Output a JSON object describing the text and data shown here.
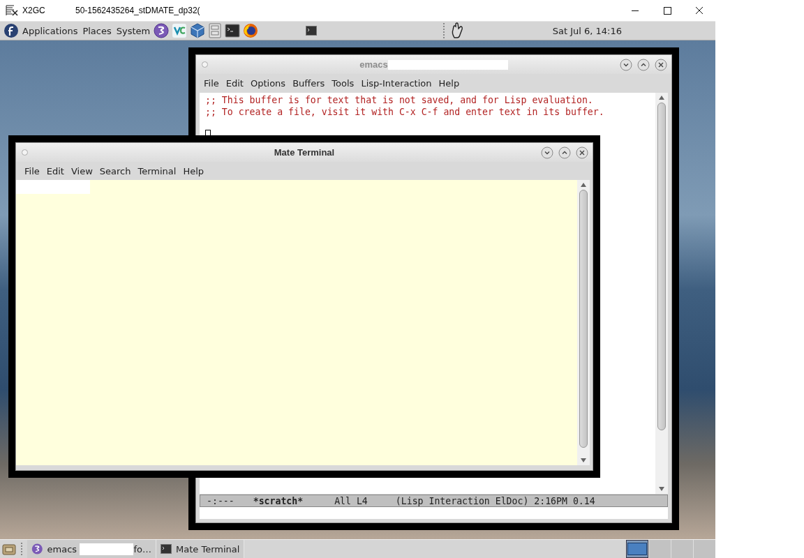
{
  "host_window": {
    "title": "X2GC",
    "session": "50-1562435264_stDMATE_dp32("
  },
  "panel": {
    "menus": [
      "Applications",
      "Places",
      "System"
    ],
    "launchers": [
      {
        "kind": "emacs"
      },
      {
        "kind": "vscode"
      },
      {
        "kind": "virtualbox"
      },
      {
        "kind": "cabinet"
      },
      {
        "kind": "terminal"
      },
      {
        "kind": "firefox"
      }
    ],
    "clock": "Sat Jul  6, 14:16"
  },
  "emacs_window": {
    "title": "emacs",
    "active": false,
    "menus": [
      "File",
      "Edit",
      "Options",
      "Buffers",
      "Tools",
      "Lisp-Interaction",
      "Help"
    ],
    "lines": [
      ";; This buffer is for text that is not saved, and for Lisp evaluation.",
      ";; To create a file, visit it with C-x C-f and enter text in its buffer."
    ],
    "mode_line": [
      {
        "text": "-:---",
        "bold": false
      },
      {
        "text": "*scratch*",
        "bold": true
      },
      {
        "text": "All L4",
        "bold": false
      },
      {
        "text": "(Lisp Interaction ElDoc) 2:16PM 0.14",
        "bold": false
      }
    ]
  },
  "terminal_window": {
    "title": "Mate Terminal",
    "active": true,
    "menus": [
      "File",
      "Edit",
      "View",
      "Search",
      "Terminal",
      "Help"
    ]
  },
  "taskbar": {
    "tasks": [
      {
        "kind": "emacs",
        "label": "emacs",
        "label_tail": "fo…"
      },
      {
        "kind": "terminal",
        "label": "Mate Terminal"
      }
    ],
    "workspaces": [
      {
        "selected": true
      },
      {
        "selected": false
      },
      {
        "selected": false
      },
      {
        "selected": false
      }
    ]
  }
}
